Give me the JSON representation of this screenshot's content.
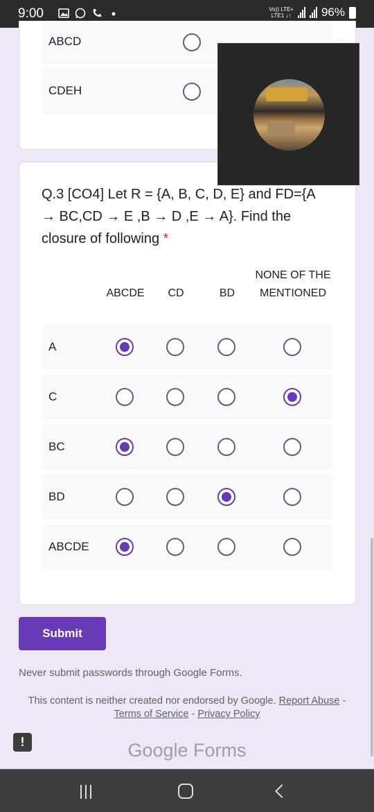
{
  "status_bar": {
    "time": "9:00",
    "network": "Vo)) LTE+\nLTE1 ↓↑",
    "battery": "96%"
  },
  "prev_question": {
    "options": [
      {
        "label": "ABCD",
        "checked": false
      },
      {
        "label": "CDEH",
        "checked": false
      }
    ]
  },
  "question": {
    "title": "Q.3 [CO4] Let R = {A, B, C, D, E} and FD={A → BC,CD → E ,B → D ,E → A}. Find the closure of following",
    "required_marker": "*",
    "columns": [
      "ABCDE",
      "CD",
      "BD",
      "NONE OF THE MENTIONED"
    ],
    "rows": [
      {
        "label": "A",
        "selected": 0
      },
      {
        "label": "C",
        "selected": 3
      },
      {
        "label": "BC",
        "selected": 0
      },
      {
        "label": "BD",
        "selected": 2
      },
      {
        "label": "ABCDE",
        "selected": 0
      }
    ]
  },
  "submit_label": "Submit",
  "warning": "Never submit passwords through Google Forms.",
  "disclaimer": {
    "text": "This content is neither created nor endorsed by Google.",
    "report": "Report Abuse",
    "sep1": " - ",
    "terms": "Terms of Service",
    "sep2": " - ",
    "privacy": "Privacy Policy"
  },
  "logo": "Google Forms",
  "colors": {
    "accent": "#673ab7",
    "background": "#ede7f6",
    "required": "#d93025"
  }
}
